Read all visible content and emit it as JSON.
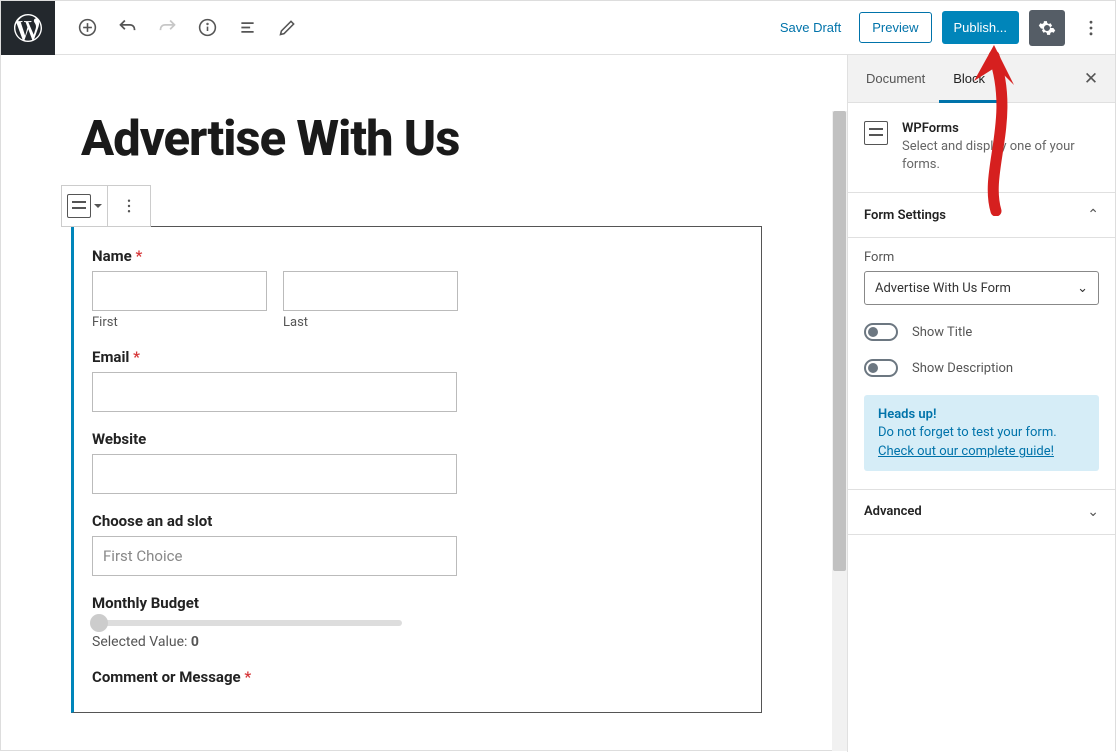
{
  "toolbar": {
    "save_draft": "Save Draft",
    "preview": "Preview",
    "publish": "Publish..."
  },
  "editor": {
    "page_title": "Advertise With Us",
    "form": {
      "name_label": "Name",
      "first_sublabel": "First",
      "last_sublabel": "Last",
      "email_label": "Email",
      "website_label": "Website",
      "adslot_label": "Choose an ad slot",
      "adslot_placeholder": "First Choice",
      "budget_label": "Monthly Budget",
      "budget_value_prefix": "Selected Value: ",
      "budget_value": "0",
      "comment_label": "Comment or Message"
    }
  },
  "sidebar": {
    "tabs": {
      "document": "Document",
      "block": "Block"
    },
    "block_info": {
      "title": "WPForms",
      "desc": "Select and display one of your forms."
    },
    "form_settings": {
      "title": "Form Settings",
      "form_label": "Form",
      "form_selected": "Advertise With Us Form",
      "show_title": "Show Title",
      "show_description": "Show Description"
    },
    "notice": {
      "heading": "Heads up!",
      "text": "Do not forget to test your form.",
      "link": "Check out our complete guide!"
    },
    "advanced": "Advanced"
  }
}
